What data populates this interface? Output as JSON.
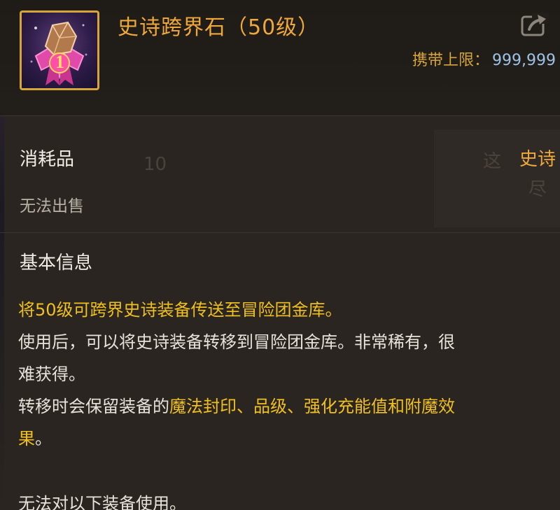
{
  "item": {
    "name": "史诗跨界石（50级）",
    "carry_label": "携带上限：",
    "carry_value": "999,999",
    "icon": "epic-cross-stone-icon",
    "icon_badge_number": "1"
  },
  "info": {
    "category": "消耗品",
    "rarity": "史诗",
    "sale_status": "无法出售"
  },
  "basic": {
    "section_title": "基本信息",
    "line1": "将50级可跨界史诗装备传送至冒险团金库。",
    "line2": "使用后，可以将史诗装备转移到冒险团金库。非常稀有，很",
    "line3": "难获得。",
    "line4_prefix": "转移时会保留装备的",
    "line4_highlight": "魔法封印、品级、强化充能值和附魔效",
    "line5_highlight": "果",
    "line5_suffix": "。",
    "note": "无法对以下装备使用。"
  },
  "background_ghost": {
    "number": "10",
    "text1": "这",
    "text2": "尽"
  },
  "colors": {
    "title_orange": "#f0a83a",
    "highlight_yellow": "#f0c020",
    "carry_value_blue": "#9ec2e6",
    "frame_gold": "#d7a43a"
  }
}
